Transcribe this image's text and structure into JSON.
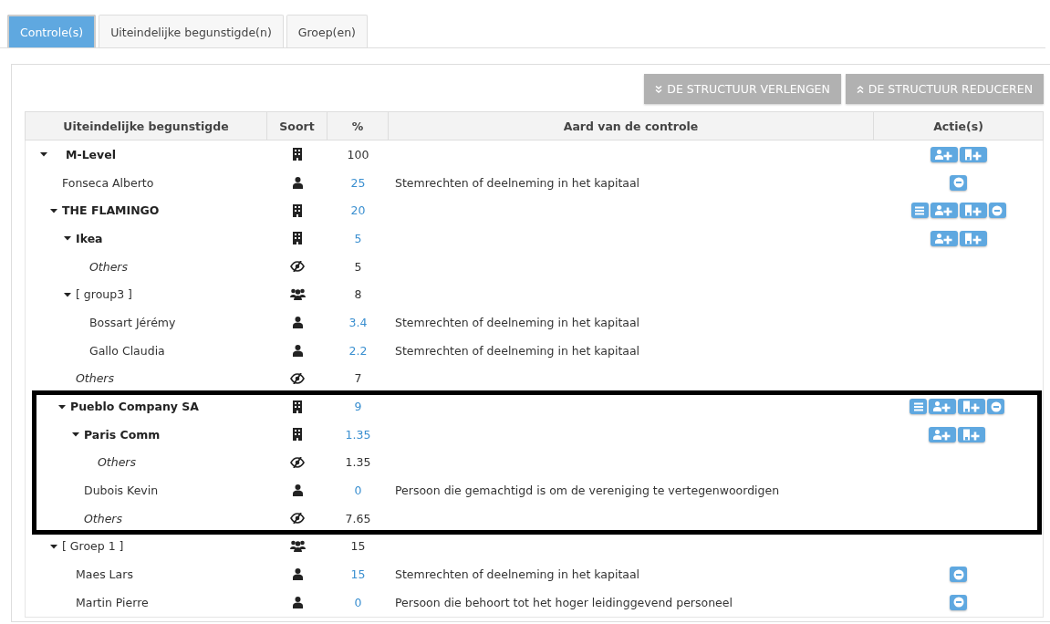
{
  "tabs": [
    {
      "label": "Controle(s)",
      "selected": true
    },
    {
      "label": "Uiteindelijke begunstigde(n)",
      "selected": false
    },
    {
      "label": "Groep(en)",
      "selected": false
    }
  ],
  "buttons": [
    {
      "kind": "expand",
      "label": "DE STRUCTUUR VERLENGEN"
    },
    {
      "kind": "collapse",
      "label": "DE STRUCTUUR REDUCEREN"
    }
  ],
  "table": {
    "columns": [
      "Uiteindelijke begunstigde",
      "Soort",
      "%",
      "Aard van de controle",
      "Actie(s)"
    ],
    "rows": [
      {
        "name": "M-Level",
        "kind": "organisation",
        "percent": "100",
        "link": false,
        "expanded": true,
        "actions": [
          {
            "kind": "add-person"
          },
          {
            "kind": "add-organisation"
          }
        ],
        "children": [
          {
            "name": "Fonseca Alberto",
            "kind": "person",
            "percent": "25",
            "link": true,
            "control": "Stemrechten of deelneming in het kapitaal",
            "actions": [
              {
                "kind": "remove"
              }
            ]
          },
          {
            "name": "THE FLAMINGO",
            "kind": "organisation",
            "percent": "20",
            "link": true,
            "expanded": true,
            "actions": [
              {
                "kind": "list"
              },
              {
                "kind": "add-person"
              },
              {
                "kind": "add-organisation"
              },
              {
                "kind": "remove"
              }
            ],
            "children": [
              {
                "name": "Ikea",
                "kind": "organisation",
                "percent": "5",
                "link": true,
                "expanded": true,
                "actions": [
                  {
                    "kind": "add-person"
                  },
                  {
                    "kind": "add-organisation"
                  }
                ],
                "children": [
                  {
                    "name": "Others",
                    "kind": "others",
                    "percent": "5",
                    "link": false
                  }
                ]
              },
              {
                "name": "[ group3 ]",
                "kind": "group",
                "percent": "8",
                "link": false,
                "expanded": true,
                "children": [
                  {
                    "name": "Bossart Jérémy",
                    "kind": "person",
                    "percent": "3.4",
                    "link": true,
                    "control": "Stemrechten of deelneming in het kapitaal"
                  },
                  {
                    "name": "Gallo Claudia",
                    "kind": "person",
                    "percent": "2.2",
                    "link": true,
                    "control": "Stemrechten of deelneming in het kapitaal"
                  }
                ]
              },
              {
                "name": "Others",
                "kind": "others",
                "percent": "7",
                "link": false
              }
            ]
          },
          {
            "name": "Pueblo Company SA",
            "kind": "organisation",
            "percent": "9",
            "link": true,
            "expanded": true,
            "highlighted": true,
            "actions": [
              {
                "kind": "list"
              },
              {
                "kind": "add-person"
              },
              {
                "kind": "add-organisation"
              },
              {
                "kind": "remove"
              }
            ],
            "children": [
              {
                "name": "Paris Comm",
                "kind": "organisation",
                "percent": "1.35",
                "link": true,
                "expanded": true,
                "actions": [
                  {
                    "kind": "add-person"
                  },
                  {
                    "kind": "add-organisation"
                  }
                ],
                "children": [
                  {
                    "name": "Others",
                    "kind": "others",
                    "percent": "1.35",
                    "link": false
                  }
                ]
              },
              {
                "name": "Dubois Kevin",
                "kind": "person",
                "percent": "0",
                "link": true,
                "control": "Persoon die gemachtigd is om de vereniging te vertegenwoordigen"
              },
              {
                "name": "Others",
                "kind": "others",
                "percent": "7.65",
                "link": false
              }
            ]
          },
          {
            "name": "[ Groep 1 ]",
            "kind": "group",
            "percent": "15",
            "link": false,
            "expanded": true,
            "children": [
              {
                "name": "Maes Lars",
                "kind": "person",
                "percent": "15",
                "link": true,
                "control": "Stemrechten of deelneming in het kapitaal",
                "actions": [
                  {
                    "kind": "remove"
                  }
                ]
              },
              {
                "name": "Martin Pierre",
                "kind": "person",
                "percent": "0",
                "link": true,
                "control": "Persoon die behoort tot het hoger leidinggevend personeel",
                "actions": [
                  {
                    "kind": "remove"
                  }
                ]
              }
            ]
          }
        ]
      }
    ]
  }
}
